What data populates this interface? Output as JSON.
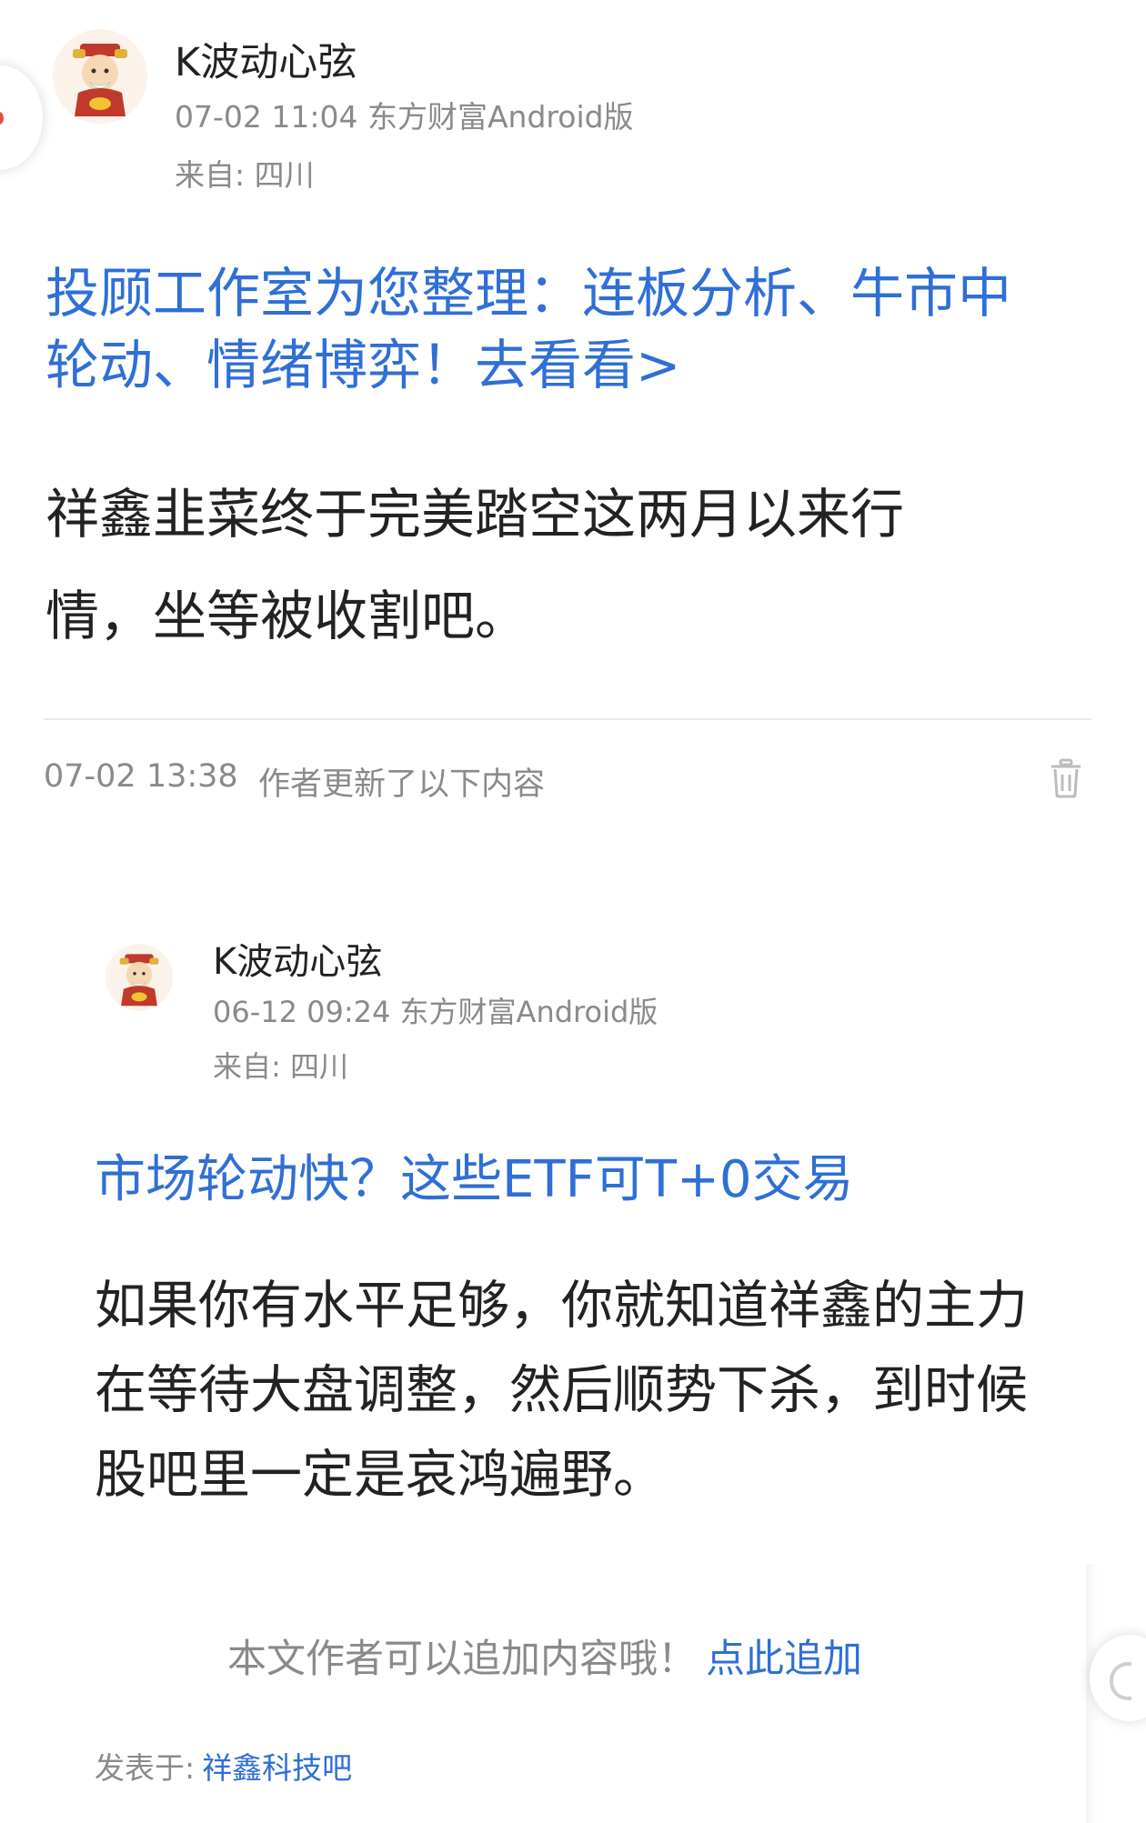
{
  "post": {
    "author": "K波动心弦",
    "meta": "07-02 11:04 东方财富Android版",
    "location": "来自: 四川",
    "promo_link": "投顾工作室为您整理：连板分析、牛市中轮动、情绪博弈！去看看>",
    "body": "祥鑫韭菜终于完美踏空这两月以来行情，坐等被收割吧。"
  },
  "update": {
    "time": "07-02 13:38",
    "label": "作者更新了以下内容"
  },
  "quoted_post": {
    "author": "K波动心弦",
    "meta": "06-12 09:24 东方财富Android版",
    "location": "来自: 四川",
    "promo_link": "市场轮动快？这些ETF可T+0交易",
    "body": "如果你有水平足够，你就知道祥鑫的主力在等待大盘调整，然后顺势下杀，到时候股吧里一定是哀鸿遍野。"
  },
  "footer": {
    "append_hint": "本文作者可以追加内容哦！",
    "append_link": "点此追加",
    "posted_in_label": "发表于:",
    "posted_in_link": "祥鑫科技吧"
  },
  "icons": {
    "avatar": "caishen-avatar-icon",
    "trash": "trash-icon"
  },
  "colors": {
    "link_blue": "#2f6fd6",
    "muted_gray": "#8a8a8a"
  }
}
